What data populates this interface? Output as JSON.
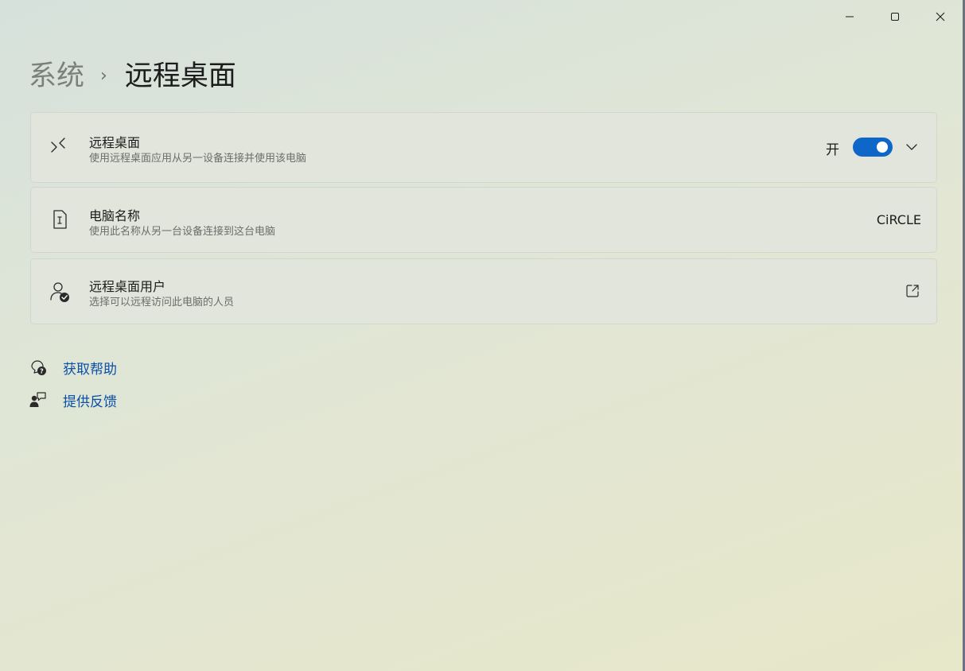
{
  "window": {
    "caption_buttons": [
      "minimize-icon",
      "maximize-icon",
      "close-icon"
    ]
  },
  "breadcrumb": {
    "parent": "系统",
    "separator": "›",
    "current": "远程桌面"
  },
  "cards": {
    "remote_desktop": {
      "icon": "remote-desktop-icon",
      "title": "远程桌面",
      "description": "使用远程桌面应用从另一设备连接并使用该电脑",
      "toggle_state_label": "开",
      "toggle_on": true,
      "expand_icon": "chevron-down-icon"
    },
    "pc_name": {
      "icon": "pc-name-icon",
      "title": "电脑名称",
      "description": "使用此名称从另一台设备连接到这台电脑",
      "value": "CiRCLE"
    },
    "remote_users": {
      "icon": "user-check-icon",
      "title": "远程桌面用户",
      "description": "选择可以远程访问此电脑的人员",
      "action_icon": "external-link-icon"
    }
  },
  "footer_links": {
    "help": {
      "icon": "help-icon",
      "label": "获取帮助"
    },
    "feedback": {
      "icon": "feedback-icon",
      "label": "提供反馈"
    }
  },
  "colors": {
    "accent": "#0f66c9",
    "link": "#0a4fa8"
  }
}
